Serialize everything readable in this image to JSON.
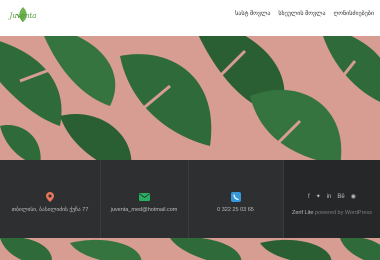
{
  "header": {
    "logo_text": "Juventa",
    "nav": [
      "სასტ მოვლა",
      "სხეულის მოვლა",
      "ღონისძიებები"
    ]
  },
  "contact": {
    "address": "თბილისი, ბასილიძის ქუჩა 77",
    "email": "juventa_med@hotmail.com",
    "phone": "0 322 25 03 65"
  },
  "social": {
    "icons": [
      "facebook-icon",
      "twitter-icon",
      "linkedin-icon",
      "behance-icon",
      "pinterest-icon"
    ]
  },
  "footer_credit": {
    "theme": "Zerif Lite",
    "powered_by": "powered by",
    "platform": "WordPress"
  },
  "colors": {
    "hero_bg": "#d79d93",
    "leaf": "#2f6b3a",
    "footer_bg": "#2e2f31",
    "location_icon": "#e8775a",
    "email_icon": "#27ae60",
    "phone_icon": "#3498db"
  }
}
